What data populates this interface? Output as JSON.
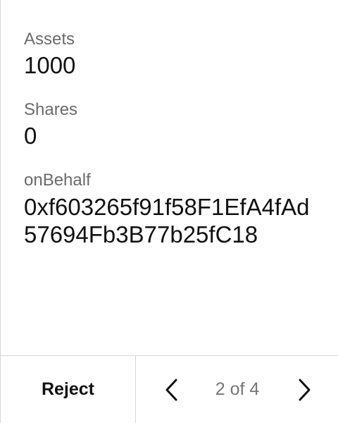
{
  "fields": [
    {
      "label": "Assets",
      "value": "1000"
    },
    {
      "label": "Shares",
      "value": "0"
    },
    {
      "label": "onBehalf",
      "value": "0xf603265f91f58F1EfA4fAd57694Fb3B77b25fC18"
    }
  ],
  "footer": {
    "reject_label": "Reject",
    "page_indicator": "2 of 4",
    "current_page": 2,
    "total_pages": 4,
    "prev_icon": "chevron-left-icon",
    "next_icon": "chevron-right-icon"
  },
  "colors": {
    "label_text": "#6b6b6b",
    "value_text": "#111111",
    "divider": "#d4d4d4",
    "pager_text": "#777777"
  }
}
